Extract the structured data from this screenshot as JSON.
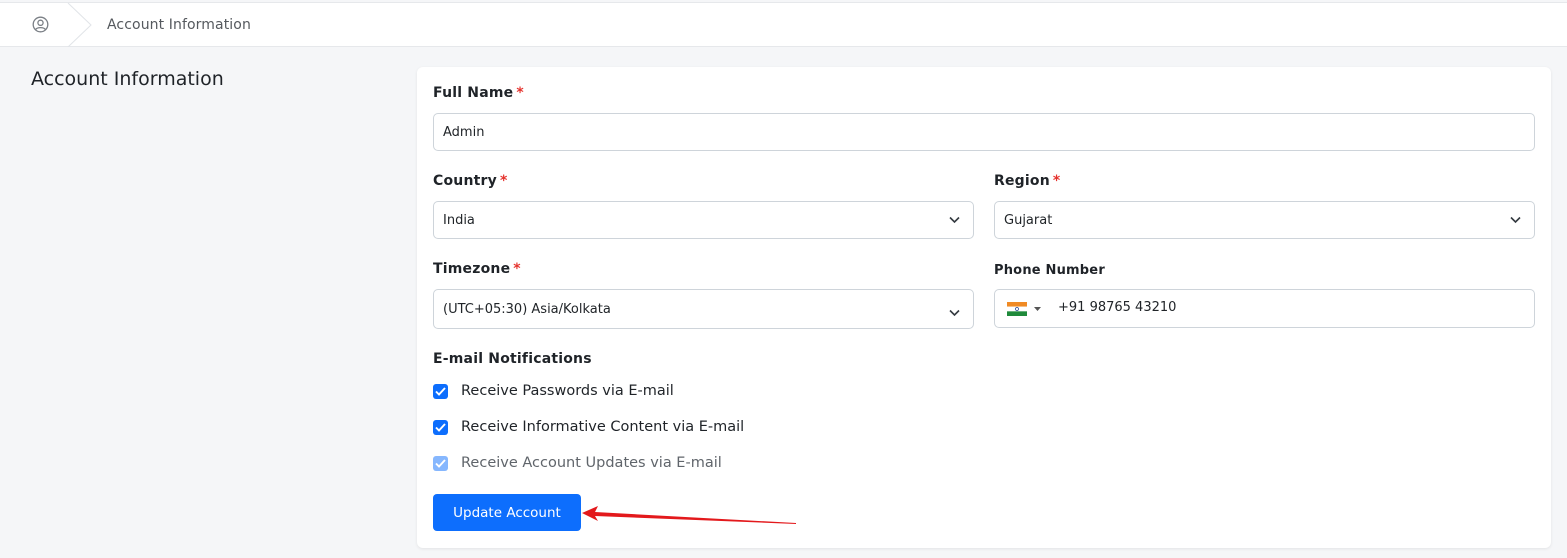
{
  "breadcrumb": {
    "home_icon": "user-circle-icon",
    "current": "Account Information"
  },
  "page": {
    "title": "Account Information"
  },
  "form": {
    "full_name": {
      "label": "Full Name",
      "required_mark": "*",
      "value": "Admin"
    },
    "country": {
      "label": "Country",
      "required_mark": "*",
      "value": "India",
      "icon": "chevron-down-icon"
    },
    "region": {
      "label": "Region",
      "required_mark": "*",
      "value": "Gujarat",
      "icon": "chevron-down-icon"
    },
    "timezone": {
      "label": "Timezone",
      "required_mark": "*",
      "value": "(UTC+05:30) Asia/Kolkata",
      "icon": "chevron-down-icon"
    },
    "phone": {
      "label": "Phone Number",
      "country_flag": "india-flag-icon",
      "value": "+91 98765 43210"
    },
    "notifications": {
      "heading": "E-mail Notifications",
      "items": [
        {
          "label": "Receive Passwords via E-mail",
          "checked": true,
          "disabled": false
        },
        {
          "label": "Receive Informative Content via E-mail",
          "checked": true,
          "disabled": false
        },
        {
          "label": "Receive Account Updates via E-mail",
          "checked": true,
          "disabled": true
        }
      ]
    },
    "submit_label": "Update Account"
  },
  "annotation": {
    "arrow_color": "#e3191c",
    "points_to": "Update Account"
  },
  "colors": {
    "accent": "#0d6efd",
    "required": "#e5322d",
    "background": "#f5f6f8"
  }
}
